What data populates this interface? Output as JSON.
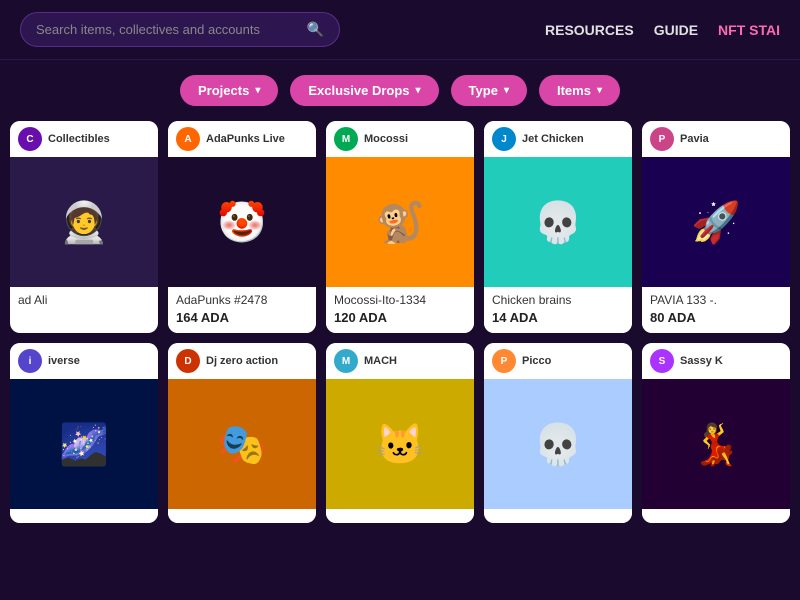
{
  "header": {
    "search_placeholder": "Search items, collectives and accounts",
    "nav_items": [
      {
        "id": "resources",
        "label": "RESOURCES"
      },
      {
        "id": "guide",
        "label": "GUIDE"
      },
      {
        "id": "nft-stai",
        "label": "NFT STAI"
      }
    ]
  },
  "filters": [
    {
      "id": "projects",
      "label": "Projects",
      "icon": "▾"
    },
    {
      "id": "exclusive-drops",
      "label": "Exclusive Drops",
      "icon": "▾"
    },
    {
      "id": "type",
      "label": "Type",
      "icon": "▾"
    },
    {
      "id": "items",
      "label": "Items",
      "icon": "▾"
    }
  ],
  "nft_cards_row1": [
    {
      "id": "collectibles",
      "collection": "Collectibles",
      "avatar_color": "#6a0dad",
      "avatar_text": "C",
      "name": "ad Ali",
      "price": "",
      "bg_color": "#2a1a4a",
      "emoji": "🧑‍🚀"
    },
    {
      "id": "adapunks",
      "collection": "AdaPunks Live",
      "avatar_color": "#ff6600",
      "avatar_text": "A",
      "name": "AdaPunks #2478",
      "price": "164 ADA",
      "bg_color": "#1a0a2e",
      "emoji": "🤡"
    },
    {
      "id": "mocossi",
      "collection": "Mocossi",
      "avatar_color": "#00aa55",
      "avatar_text": "M",
      "name": "Mocossi-Ito-1334",
      "price": "120 ADA",
      "bg_color": "#ff8c00",
      "emoji": "🐒"
    },
    {
      "id": "jet-chicken",
      "collection": "Jet Chicken",
      "avatar_color": "#0088cc",
      "avatar_text": "J",
      "name": "Chicken brains",
      "price": "14 ADA",
      "bg_color": "#22ccbb",
      "emoji": "💀"
    },
    {
      "id": "pavia",
      "collection": "Pavia",
      "avatar_color": "#cc4488",
      "avatar_text": "P",
      "name": "PAVIA 133 -.",
      "price": "80 ADA",
      "bg_color": "#1a0050",
      "emoji": "🚀"
    }
  ],
  "nft_cards_row2": [
    {
      "id": "iverse",
      "collection": "iverse",
      "avatar_color": "#5544cc",
      "avatar_text": "i",
      "name": "",
      "price": "",
      "bg_color": "#001144",
      "emoji": "🌌"
    },
    {
      "id": "dj-zero",
      "collection": "Dj zero action",
      "avatar_color": "#cc3300",
      "avatar_text": "D",
      "name": "",
      "price": "",
      "bg_color": "#cc6600",
      "emoji": "🎭"
    },
    {
      "id": "mach",
      "collection": "MACH",
      "avatar_color": "#33aacc",
      "avatar_text": "M",
      "name": "",
      "price": "",
      "bg_color": "#ccaa00",
      "emoji": "🐱"
    },
    {
      "id": "picco",
      "collection": "Picco",
      "avatar_color": "#ff8833",
      "avatar_text": "P",
      "name": "",
      "price": "",
      "bg_color": "#aaccff",
      "emoji": "💀"
    },
    {
      "id": "sassy",
      "collection": "Sassy K",
      "avatar_color": "#aa33ff",
      "avatar_text": "S",
      "name": "",
      "price": "",
      "bg_color": "#220033",
      "emoji": "💃"
    }
  ],
  "colors": {
    "bg_dark": "#1a0a2e",
    "accent_pink": "#d946a8",
    "card_bg": "#ffffff"
  }
}
